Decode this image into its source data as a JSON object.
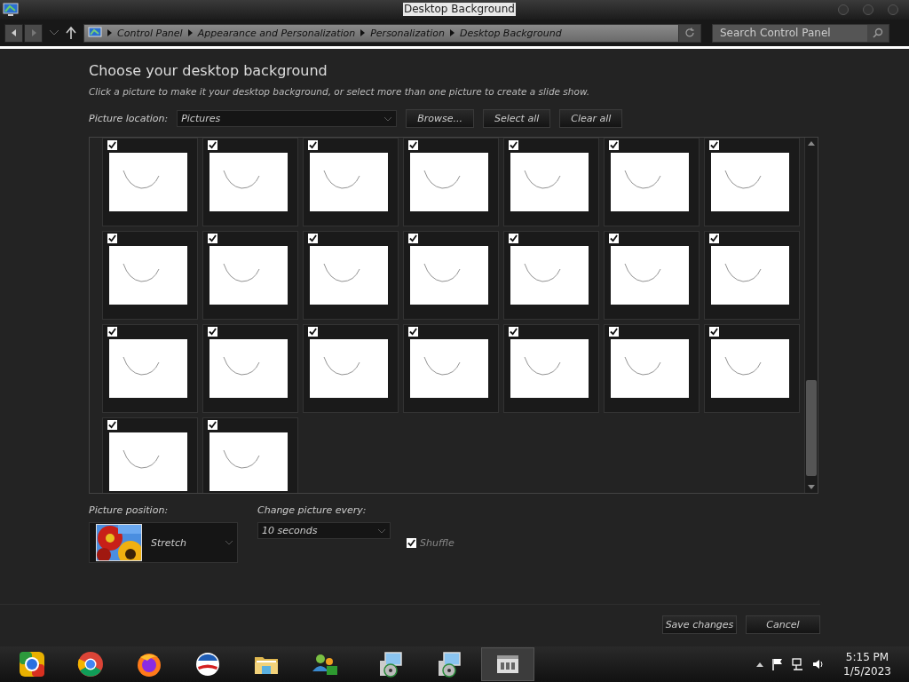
{
  "window": {
    "title": "Desktop Background"
  },
  "address_bar": {
    "breadcrumbs": [
      "Control Panel",
      "Appearance and Personalization",
      "Personalization",
      "Desktop Background"
    ]
  },
  "search": {
    "placeholder": "Search Control Panel"
  },
  "heading": "Choose your desktop background",
  "instructions": "Click a picture to make it your desktop background, or select more than one picture to create a slide show.",
  "picture_location": {
    "label": "Picture location:",
    "value": "Pictures"
  },
  "buttons": [
    "Browse...",
    "Select all",
    "Clear all"
  ],
  "pictures": [
    {
      "checked": true
    },
    {
      "checked": true
    },
    {
      "checked": true
    },
    {
      "checked": true
    },
    {
      "checked": true
    },
    {
      "checked": true
    },
    {
      "checked": true
    },
    {
      "checked": true
    },
    {
      "checked": true
    },
    {
      "checked": true
    },
    {
      "checked": true
    },
    {
      "checked": true
    },
    {
      "checked": true
    },
    {
      "checked": true
    },
    {
      "checked": true
    },
    {
      "checked": true
    },
    {
      "checked": true
    },
    {
      "checked": true
    },
    {
      "checked": true
    },
    {
      "checked": true
    },
    {
      "checked": true
    },
    {
      "checked": true
    },
    {
      "checked": true
    }
  ],
  "picture_position": {
    "label": "Picture position:",
    "value": "Stretch"
  },
  "change_picture": {
    "label": "Change picture every:",
    "value": "10 seconds"
  },
  "shuffle": {
    "label": "Shuffle",
    "checked": true
  },
  "footer_buttons": [
    "Save changes",
    "Cancel"
  ],
  "taskbar": {
    "apps": [
      {
        "kind": "tiles",
        "selected": false
      },
      {
        "kind": "chrome",
        "selected": false
      },
      {
        "kind": "firefox",
        "selected": false
      },
      {
        "kind": "logo",
        "selected": false
      },
      {
        "kind": "folder",
        "selected": false
      },
      {
        "kind": "people",
        "selected": false
      },
      {
        "kind": "installer",
        "selected": false
      },
      {
        "kind": "installer",
        "selected": false
      },
      {
        "kind": "panel",
        "selected": true
      }
    ],
    "time": "5:15 PM",
    "date": "1/5/2023"
  }
}
